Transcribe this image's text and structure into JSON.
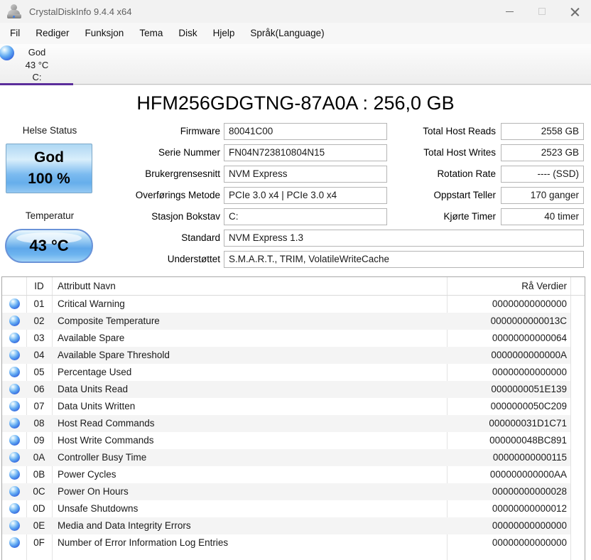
{
  "window": {
    "title": "CrystalDiskInfo 9.4.4 x64"
  },
  "menu": {
    "items": [
      "Fil",
      "Rediger",
      "Funksjon",
      "Tema",
      "Disk",
      "Hjelp",
      "Språk(Language)"
    ]
  },
  "drive_tab": {
    "status": "God",
    "temperature": "43 °C",
    "letter": "C:"
  },
  "disk": {
    "title": "HFM256GDGTNG-87A0A : 256,0 GB"
  },
  "health": {
    "label": "Helse Status",
    "status": "God",
    "percent": "100 %"
  },
  "temperature": {
    "label": "Temperatur",
    "value": "43 °C"
  },
  "info_left": [
    {
      "label": "Firmware",
      "value": "80041C00"
    },
    {
      "label": "Serie Nummer",
      "value": "FN04N723810804N15"
    },
    {
      "label": "Brukergrensesnitt",
      "value": "NVM Express"
    },
    {
      "label": "Overførings Metode",
      "value": "PCIe 3.0 x4 | PCIe 3.0 x4"
    },
    {
      "label": "Stasjon Bokstav",
      "value": "C:"
    },
    {
      "label": "Standard",
      "value": "NVM Express 1.3"
    },
    {
      "label": "Understøttet",
      "value": "S.M.A.R.T., TRIM, VolatileWriteCache"
    }
  ],
  "info_right": [
    {
      "label": "Total Host Reads",
      "value": "2558 GB"
    },
    {
      "label": "Total Host Writes",
      "value": "2523 GB"
    },
    {
      "label": "Rotation Rate",
      "value": "---- (SSD)"
    },
    {
      "label": "Oppstart Teller",
      "value": "170 ganger"
    },
    {
      "label": "Kjørte Timer",
      "value": "40 timer"
    }
  ],
  "smart_table": {
    "headers": {
      "id": "ID",
      "name": "Attributt Navn",
      "raw": "Rå Verdier"
    },
    "rows": [
      {
        "id": "01",
        "name": "Critical Warning",
        "raw": "00000000000000"
      },
      {
        "id": "02",
        "name": "Composite Temperature",
        "raw": "0000000000013C"
      },
      {
        "id": "03",
        "name": "Available Spare",
        "raw": "00000000000064"
      },
      {
        "id": "04",
        "name": "Available Spare Threshold",
        "raw": "0000000000000A"
      },
      {
        "id": "05",
        "name": "Percentage Used",
        "raw": "00000000000000"
      },
      {
        "id": "06",
        "name": "Data Units Read",
        "raw": "0000000051E139"
      },
      {
        "id": "07",
        "name": "Data Units Written",
        "raw": "0000000050C209"
      },
      {
        "id": "08",
        "name": "Host Read Commands",
        "raw": "000000031D1C71"
      },
      {
        "id": "09",
        "name": "Host Write Commands",
        "raw": "000000048BC891"
      },
      {
        "id": "0A",
        "name": "Controller Busy Time",
        "raw": "00000000000115"
      },
      {
        "id": "0B",
        "name": "Power Cycles",
        "raw": "000000000000AA"
      },
      {
        "id": "0C",
        "name": "Power On Hours",
        "raw": "00000000000028"
      },
      {
        "id": "0D",
        "name": "Unsafe Shutdowns",
        "raw": "00000000000012"
      },
      {
        "id": "0E",
        "name": "Media and Data Integrity Errors",
        "raw": "00000000000000"
      },
      {
        "id": "0F",
        "name": "Number of Error Information Log Entries",
        "raw": "00000000000000"
      }
    ]
  },
  "colors": {
    "accent_purple": "#5b2d9b",
    "health_blue": "#6cb2ec",
    "status_orb_blue": "#3f7de0"
  }
}
